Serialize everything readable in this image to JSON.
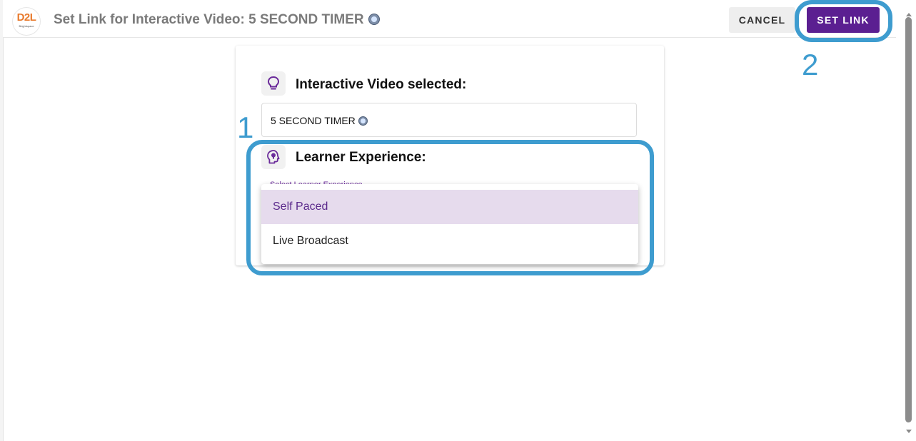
{
  "header": {
    "logo_text": "D2L",
    "logo_subtext": "Brightspace",
    "title": "Set Link for Interactive Video: 5 SECOND TIMER",
    "title_icon": "timer-emoji-icon",
    "cancel_label": "CANCEL",
    "set_link_label": "SET LINK"
  },
  "video_section": {
    "icon": "lightbulb-icon",
    "heading": "Interactive Video selected:",
    "selected_video": "5 SECOND TIMER",
    "selected_video_icon": "timer-emoji-icon"
  },
  "experience_section": {
    "icon": "head-lightbulb-icon",
    "heading": "Learner Experience:",
    "select_label": "Select Learner Experience",
    "options": [
      {
        "label": "Self Paced",
        "selected": true
      },
      {
        "label": "Live Broadcast",
        "selected": false
      }
    ]
  },
  "annotations": {
    "step_1": "1",
    "step_2": "2",
    "color": "#3e9ccf"
  },
  "colors": {
    "accent": "#5b1f91",
    "selected_option_bg": "#e6dbed",
    "logo_orange": "#e8792b"
  }
}
